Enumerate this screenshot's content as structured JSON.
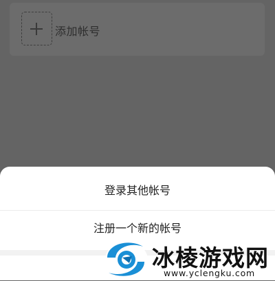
{
  "account_list": {
    "add_account_label": "添加帐号",
    "add_icon": "plus-icon"
  },
  "action_sheet": {
    "login_other_label": "登录其他帐号",
    "register_new_label": "注册一个新的帐号"
  },
  "watermark": {
    "title": "冰棱游戏网",
    "url": "www.yclengku.com",
    "logo_icon": "swirl-logo-icon"
  },
  "colors": {
    "overlay": "#646464",
    "card": "#6c6c6c",
    "sheet": "#ffffff",
    "logo_blue": "#1a8fd6"
  }
}
